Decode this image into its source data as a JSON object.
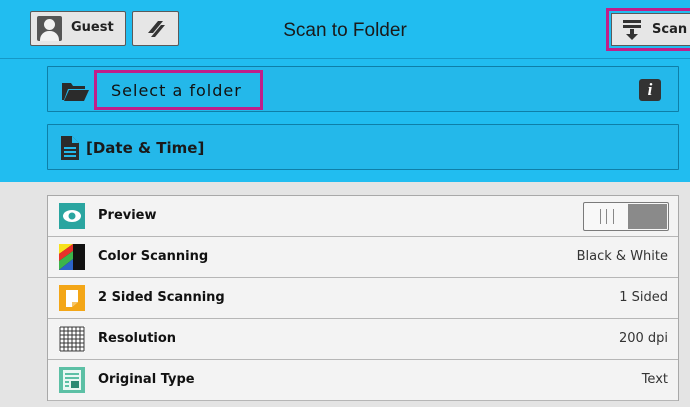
{
  "header": {
    "user_label": "Guest",
    "title": "Scan to Folder",
    "scan_label": "Scan"
  },
  "folder": {
    "placeholder": "Select a folder",
    "info_glyph": "i"
  },
  "file_name": {
    "label": "[Date & Time]"
  },
  "features": [
    {
      "name": "Preview",
      "value": "",
      "icon": "eye-icon"
    },
    {
      "name": "Color Scanning",
      "value": "Black & White",
      "icon": "color-scanning-icon"
    },
    {
      "name": "2 Sided Scanning",
      "value": "1 Sided",
      "icon": "two-sided-icon"
    },
    {
      "name": "Resolution",
      "value": "200 dpi",
      "icon": "grid-icon"
    },
    {
      "name": "Original Type",
      "value": "Text",
      "icon": "original-type-icon"
    }
  ],
  "preview_toggle": {
    "on": false
  },
  "colors": {
    "primary_blue": "#21bdf0",
    "highlight_magenta": "#c01f8a",
    "panel_grey": "#e4e4e4"
  }
}
